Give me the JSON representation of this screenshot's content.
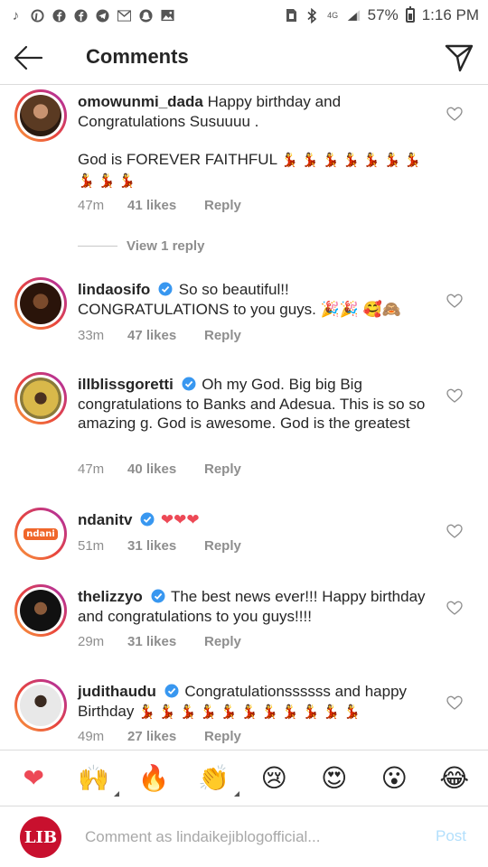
{
  "status_bar": {
    "battery": "57%",
    "time": "1:16 PM",
    "left_icons": [
      "tiktok-icon",
      "pinterest-icon",
      "facebook-icon",
      "facebook-icon",
      "telegram-icon",
      "gmail-icon",
      "snapchat-icon",
      "gallery-icon"
    ],
    "right_icons": [
      "sim-icon",
      "bluetooth-icon",
      "4g-icon",
      "signal-icon"
    ]
  },
  "header": {
    "title": "Comments"
  },
  "comments": [
    {
      "username": "omowunmi_dada",
      "verified": false,
      "text": "Happy birthday and Congratulations Susuuuu .",
      "text2": "God is FOREVER FAITHFUL",
      "dancers": 10,
      "time": "47m",
      "likes": "41 likes",
      "reply": "Reply",
      "view_replies": "View 1 reply",
      "avatar_color": "#6b4a2f"
    },
    {
      "username": "lindaosifo",
      "verified": true,
      "text": "So so beautiful!! CONGRATULATIONS to you guys. 🎉🎉 🥰🙈",
      "time": "33m",
      "likes": "47 likes",
      "reply": "Reply",
      "avatar_color": "#3b2418"
    },
    {
      "username": "illblissgoretti",
      "verified": true,
      "text": "Oh my God. Big big Big congratulations to Banks and Adesua. This is so so amazing g. God is awesome. God is the greatest",
      "time": "47m",
      "likes": "40 likes",
      "reply": "Reply",
      "avatar_color": "#e2c34a"
    },
    {
      "username": "ndanitv",
      "verified": true,
      "text": "❤❤❤",
      "time": "51m",
      "likes": "31 likes",
      "reply": "Reply",
      "avatar_logo": "ndani"
    },
    {
      "username": "thelizzyo",
      "verified": true,
      "text": "The best news ever!!! Happy birthday and congratulations to you guys!!!!",
      "time": "29m",
      "likes": "31 likes",
      "reply": "Reply",
      "avatar_color": "#2a2a2a"
    },
    {
      "username": "judithaudu",
      "verified": true,
      "text": "Congratulationssssss and happy Birthday",
      "dancers": 11,
      "time": "49m",
      "likes": "27 likes",
      "reply": "Reply",
      "avatar_color": "#d8d8d8"
    }
  ],
  "emoji_bar": [
    "❤",
    "🙌",
    "🔥",
    "👏",
    "😢",
    "😍",
    "😮",
    "😂"
  ],
  "composer": {
    "avatar_text": "LIB",
    "placeholder": "Comment as lindaikejiblogofficial...",
    "post_label": "Post"
  },
  "colors": {
    "verified_blue": "#3897f0",
    "post_blue_disabled": "#b2dffc",
    "meta_gray": "#8e8e8e",
    "heart_red": "#ed4956",
    "lib_red": "#c8102e"
  }
}
